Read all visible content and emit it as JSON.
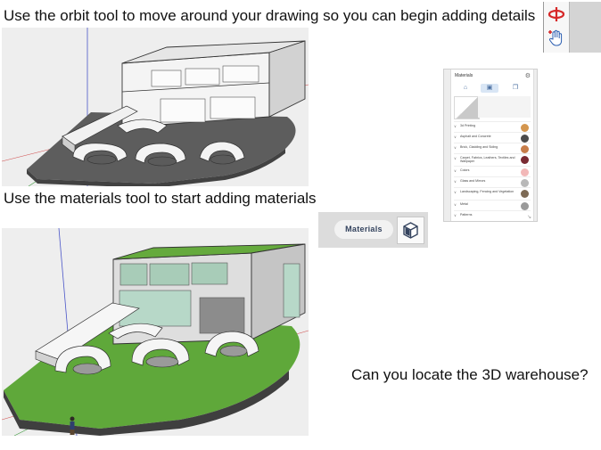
{
  "captions": {
    "orbit": "Use the orbit tool to move around your drawing so you can begin adding details",
    "materials": "Use the materials tool to start adding materials",
    "warehouse": "Can you locate the 3D warehouse?"
  },
  "toolbar": {
    "icons": [
      "orbit-icon",
      "pan-hand-icon"
    ]
  },
  "materials_panel": {
    "title": "Materials",
    "tabs": [
      "home-icon",
      "browse-materials-icon",
      "edit-materials-icon"
    ],
    "categories": [
      {
        "label": "3d Printing",
        "color": "#d4964e"
      },
      {
        "label": "Asphalt and Concrete",
        "color": "#4b4b4b"
      },
      {
        "label": "Brick, Cladding and Siding",
        "color": "#c77d4a"
      },
      {
        "label": "Carpet, Fabrics, Leathers, Textiles and Wallpaper",
        "color": "#7a2a32"
      },
      {
        "label": "Colors",
        "color": "#f2b8b8"
      },
      {
        "label": "Glass and Mirrors",
        "color": "#b8b8b8"
      },
      {
        "label": "Landscaping, Fencing and Vegetation",
        "color": "#7d6a55"
      },
      {
        "label": "Metal",
        "color": "#9a9a9a"
      },
      {
        "label": "Patterns",
        "color": "#d6d6d6"
      }
    ]
  },
  "materials_button": {
    "label": "Materials"
  },
  "colors": {
    "grass": "#5fa83a",
    "ground_grey": "#5f5f5f",
    "accent_red": "#d62828",
    "accent_blue": "#2a5db0"
  }
}
